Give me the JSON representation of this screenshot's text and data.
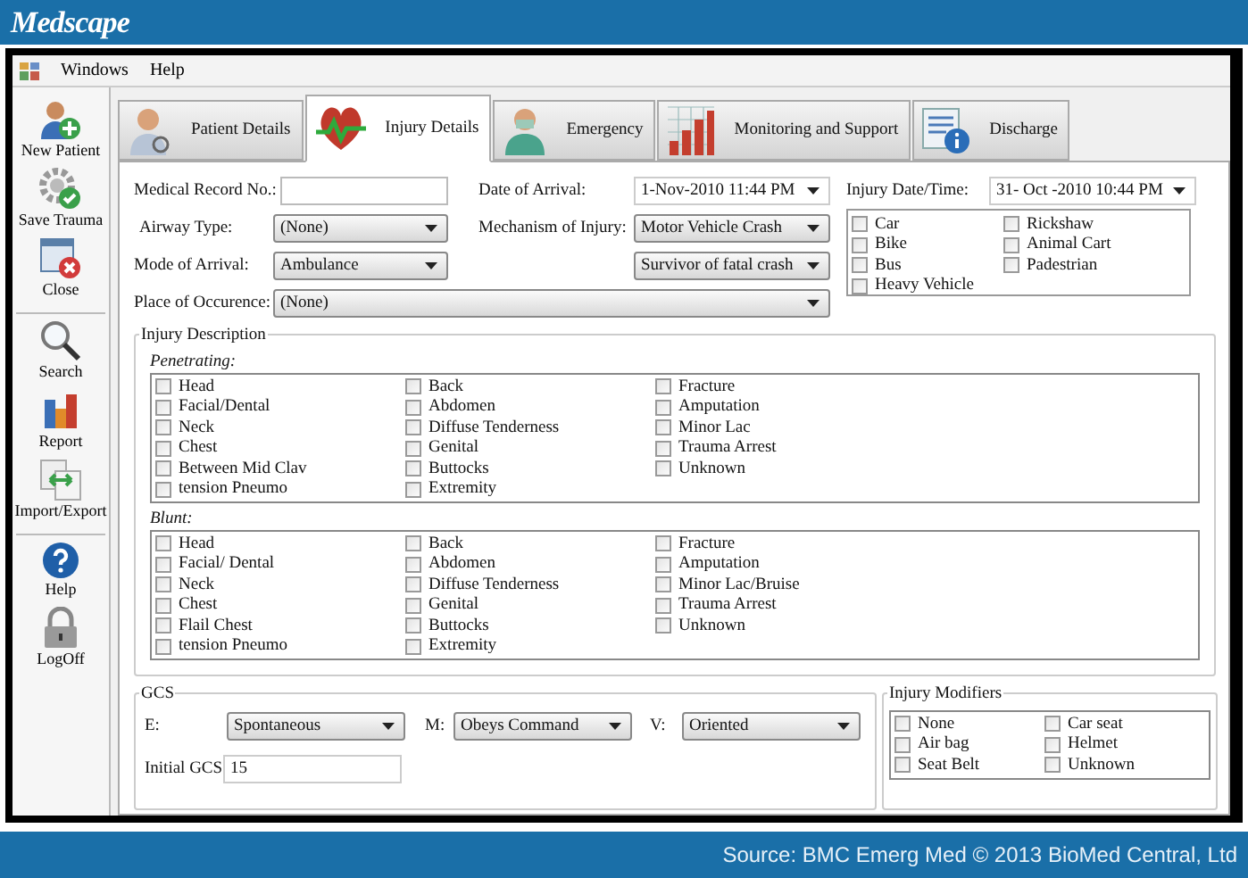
{
  "header": {
    "logo": "Medscape"
  },
  "menu": [
    {
      "label": "Windows"
    },
    {
      "label": "Help"
    }
  ],
  "toolbar": [
    {
      "items": [
        {
          "label": "New Patient",
          "kind": "new-patient"
        },
        {
          "label": "Save Trauma",
          "kind": "save"
        },
        {
          "label": "Close",
          "kind": "close"
        }
      ]
    },
    {
      "items": [
        {
          "label": "Search",
          "kind": "search"
        },
        {
          "label": "Report",
          "kind": "report"
        },
        {
          "label": "Import/Export",
          "kind": "import-export"
        }
      ]
    },
    {
      "items": [
        {
          "label": "Help",
          "kind": "help"
        },
        {
          "label": "LogOff",
          "kind": "logoff"
        }
      ]
    }
  ],
  "tabs": [
    {
      "label": "Patient Details",
      "kind": "patient",
      "selected": false
    },
    {
      "label": "Injury Details",
      "kind": "injury",
      "selected": true
    },
    {
      "label": "Emergency",
      "kind": "emergency",
      "selected": false
    },
    {
      "label": "Monitoring and Support",
      "kind": "monitoring",
      "selected": false
    },
    {
      "label": "Discharge",
      "kind": "discharge",
      "selected": false
    }
  ],
  "form": {
    "medical_record": {
      "label": "Medical Record No.:"
    },
    "airway_type": {
      "label": "Airway Type:",
      "value": "(None)"
    },
    "mode_of_arrival": {
      "label": "Mode of Arrival:",
      "value": "Ambulance"
    },
    "place_of_occurence": {
      "label": "Place of Occurence:",
      "value": "(None)"
    },
    "date_of_arrival": {
      "label": "Date of Arrival:",
      "value": "1-Nov-2010 11:44 PM"
    },
    "mechanism_of_injury": {
      "label": "Mechanism of Injury:",
      "value": "Motor Vehicle Crash"
    },
    "crash_detail": {
      "value": "Survivor of fatal crash"
    },
    "injury_date_time": {
      "label": "Injury Date/Time:",
      "value": "31- Oct -2010 10:44 PM"
    },
    "vehicles": [
      [
        {
          "label": "Car",
          "checked": false
        },
        {
          "label": "Bike",
          "checked": false
        },
        {
          "label": "Bus",
          "checked": false
        },
        {
          "label": "Heavy Vehicle",
          "checked": false
        }
      ],
      [
        {
          "label": "Rickshaw",
          "checked": false
        },
        {
          "label": "Animal Cart",
          "checked": false
        },
        {
          "label": "Padestrian",
          "checked": false
        }
      ]
    ]
  },
  "injury_description": {
    "title": "Injury Description",
    "groups": [
      {
        "title": "Penetrating:",
        "columns": [
          [
            {
              "label": "Head",
              "checked": false
            },
            {
              "label": "Facial/Dental",
              "checked": false
            },
            {
              "label": "Neck",
              "checked": false
            },
            {
              "label": "Chest",
              "checked": false
            },
            {
              "label": "Between Mid Clav",
              "checked": false
            },
            {
              "label": "tension Pneumo",
              "checked": false
            }
          ],
          [
            {
              "label": "Back",
              "checked": false
            },
            {
              "label": "Abdomen",
              "checked": false
            },
            {
              "label": "Diffuse Tenderness",
              "checked": false
            },
            {
              "label": "Genital",
              "checked": false
            },
            {
              "label": "Buttocks",
              "checked": false
            },
            {
              "label": "Extremity",
              "checked": false
            }
          ],
          [
            {
              "label": "Fracture",
              "checked": false
            },
            {
              "label": "Amputation",
              "checked": false
            },
            {
              "label": "Minor Lac",
              "checked": false
            },
            {
              "label": "Trauma Arrest",
              "checked": false
            },
            {
              "label": "Unknown",
              "checked": false
            }
          ]
        ]
      },
      {
        "title": "Blunt:",
        "columns": [
          [
            {
              "label": "Head",
              "checked": false
            },
            {
              "label": "Facial/ Dental",
              "checked": false
            },
            {
              "label": "Neck",
              "checked": false
            },
            {
              "label": "Chest",
              "checked": false
            },
            {
              "label": "Flail Chest",
              "checked": false
            },
            {
              "label": "tension Pneumo",
              "checked": false
            }
          ],
          [
            {
              "label": "Back",
              "checked": false
            },
            {
              "label": "Abdomen",
              "checked": false
            },
            {
              "label": "Diffuse Tenderness",
              "checked": false
            },
            {
              "label": "Genital",
              "checked": false
            },
            {
              "label": "Buttocks",
              "checked": false
            },
            {
              "label": "Extremity",
              "checked": false
            }
          ],
          [
            {
              "label": "Fracture",
              "checked": false
            },
            {
              "label": "Amputation",
              "checked": false
            },
            {
              "label": "Minor Lac/Bruise",
              "checked": false
            },
            {
              "label": "Trauma Arrest",
              "checked": false
            },
            {
              "label": "Unknown",
              "checked": false
            }
          ]
        ]
      }
    ]
  },
  "gcs": {
    "title": "GCS",
    "e": {
      "label": "E:",
      "value": "Spontaneous"
    },
    "m": {
      "label": "M:",
      "value": "Obeys Command"
    },
    "v": {
      "label": "V:",
      "value": "Oriented"
    },
    "initial": {
      "label": "Initial GCS",
      "value": "15"
    }
  },
  "injury_modifiers": {
    "title": "Injury Modifiers",
    "columns": [
      [
        {
          "label": "None",
          "checked": false
        },
        {
          "label": "Air bag",
          "checked": false
        },
        {
          "label": "Seat Belt",
          "checked": false
        }
      ],
      [
        {
          "label": "Car seat",
          "checked": false
        },
        {
          "label": "Helmet",
          "checked": false
        },
        {
          "label": "Unknown",
          "checked": false
        }
      ]
    ]
  },
  "footer": {
    "source": "Source: BMC Emerg Med © 2013 BioMed Central, Ltd"
  }
}
